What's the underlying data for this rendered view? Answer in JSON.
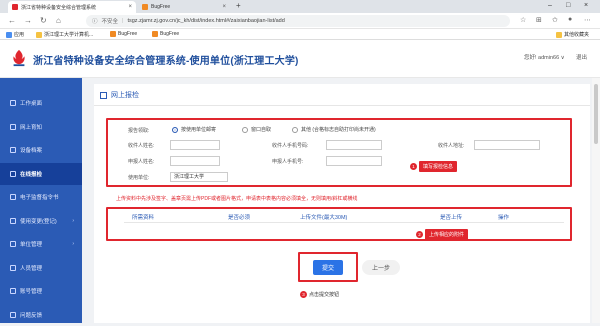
{
  "browser": {
    "tabs": [
      {
        "label": "浙江省特种设备安全综合管理系统",
        "active": true
      },
      {
        "label": "BugFree",
        "active": false
      }
    ],
    "new_tab": "+",
    "address": {
      "insecure_label": "不安全",
      "url": "tsgz.zjamr.zj.gov.cn/jc_kh/dist/index.html#/zaixianbaojian-list/add"
    },
    "bookmarks": [
      {
        "label": "应用"
      },
      {
        "label": "浙江理工大学计算机..."
      },
      {
        "label": "BugFree"
      },
      {
        "label": "BugFree"
      }
    ],
    "other_bookmarks": "其他收藏夹"
  },
  "header": {
    "title": "浙江省特种设备安全综合管理系统-使用单位(浙江理工大学)",
    "user": "您好! admin66 ∨",
    "logout": "退出"
  },
  "sidebar": {
    "items": [
      {
        "label": "工作桌面",
        "active": false,
        "arrow": false
      },
      {
        "label": "网上育知",
        "active": false,
        "arrow": false
      },
      {
        "label": "设备档案",
        "active": false,
        "arrow": false
      },
      {
        "label": "在线报检",
        "active": true,
        "arrow": false
      },
      {
        "label": "电子监督指令书",
        "active": false,
        "arrow": false
      },
      {
        "label": "使用变更(登记)",
        "active": false,
        "arrow": true
      },
      {
        "label": "单位管理",
        "active": false,
        "arrow": true
      },
      {
        "label": "人员管理",
        "active": false,
        "arrow": false
      },
      {
        "label": "账号管理",
        "active": false,
        "arrow": false
      },
      {
        "label": "问题反馈",
        "active": false,
        "arrow": false
      }
    ]
  },
  "panel": {
    "title": "网上报检"
  },
  "form": {
    "report_org_label": "报告领取:",
    "radios": [
      {
        "label": "按使用单位邮寄",
        "checked": true
      },
      {
        "label": "窗口自取",
        "checked": false
      },
      {
        "label": "其他 (合格标志自助打印尚未开通)",
        "checked": false
      }
    ],
    "fields": [
      {
        "label": "收件人姓名:",
        "value": ""
      },
      {
        "label": "收件人手机号码:",
        "value": ""
      },
      {
        "label": "收件人地址:",
        "value": ""
      },
      {
        "label": "申报人姓名:",
        "value": ""
      },
      {
        "label": "申报人手机号:",
        "value": ""
      },
      {
        "label": "使用单位:",
        "value": "浙江理工大学"
      }
    ],
    "notice": "上传资料中先涉及签字、盖章页需上传PDF或者图片格式，申请表中表格内容必须填全，无则填用/斜杠或横线"
  },
  "attachments": {
    "headers": [
      "所需资料",
      "是否必须",
      "上传文件(最大30M)",
      "是否上传",
      "操作"
    ]
  },
  "buttons": {
    "submit": "提交",
    "prev": "上一步"
  },
  "annotations": [
    {
      "num": "1",
      "text": "填写报检信息"
    },
    {
      "num": "2",
      "text": "上传相应的附件"
    },
    {
      "num": "3",
      "text": "点击提交按钮"
    }
  ],
  "colors": {
    "sidebar": "#2b5bb5",
    "sidebar_active": "#16409a",
    "title": "#1f4e9c",
    "highlight": "#e0262e",
    "submit": "#2b73e6"
  }
}
